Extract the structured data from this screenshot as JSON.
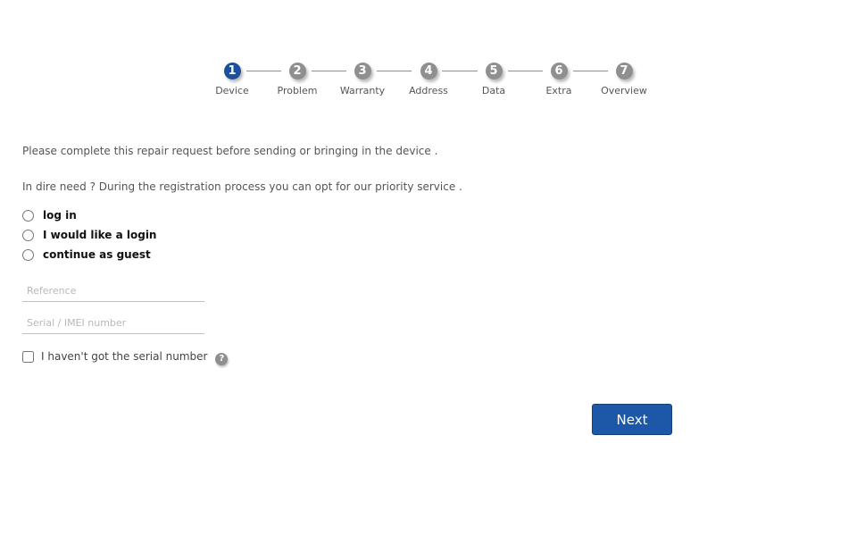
{
  "stepper": {
    "steps": [
      {
        "number": "1",
        "label": "Device",
        "active": true
      },
      {
        "number": "2",
        "label": "Problem",
        "active": false
      },
      {
        "number": "3",
        "label": "Warranty",
        "active": false
      },
      {
        "number": "4",
        "label": "Address",
        "active": false
      },
      {
        "number": "5",
        "label": "Data",
        "active": false
      },
      {
        "number": "6",
        "label": "Extra",
        "active": false
      },
      {
        "number": "7",
        "label": "Overview",
        "active": false
      }
    ],
    "active_color": "#1d4f9a",
    "inactive_color": "#8f8f8f"
  },
  "intro": {
    "line1": "Please complete this repair request before sending or bringing in the device .",
    "line2": "In dire need ? During the registration process you can opt for our priority service ."
  },
  "account_options": {
    "options": [
      {
        "label": "log in",
        "selected": false
      },
      {
        "label": "I would like a login",
        "selected": false
      },
      {
        "label": "continue as guest",
        "selected": false
      }
    ]
  },
  "fields": {
    "reference": {
      "placeholder": "Reference",
      "value": ""
    },
    "serial": {
      "placeholder": "Serial / IMEI number",
      "value": ""
    }
  },
  "no_serial": {
    "label": "I haven't got the serial number",
    "checked": false,
    "help_icon": "?"
  },
  "actions": {
    "next_label": "Next",
    "button_color": "#1d57a8"
  }
}
